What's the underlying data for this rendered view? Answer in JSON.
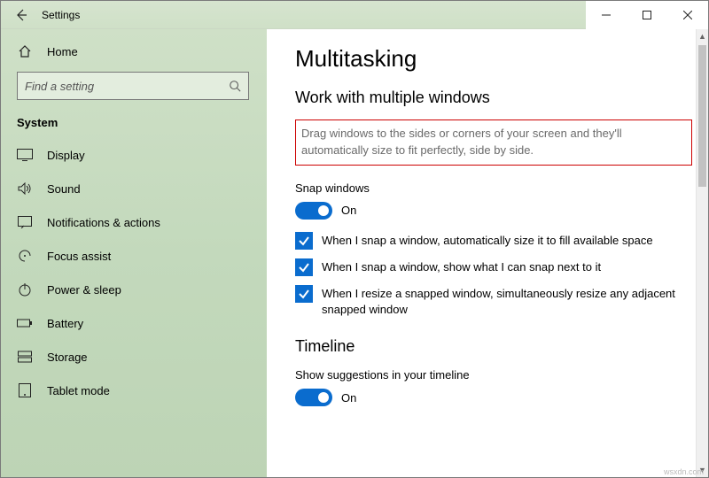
{
  "titlebar": {
    "title": "Settings"
  },
  "sidebar": {
    "home": "Home",
    "search_placeholder": "Find a setting",
    "section": "System",
    "items": [
      {
        "icon": "display",
        "label": "Display"
      },
      {
        "icon": "sound",
        "label": "Sound"
      },
      {
        "icon": "notifications",
        "label": "Notifications & actions"
      },
      {
        "icon": "focus",
        "label": "Focus assist"
      },
      {
        "icon": "power",
        "label": "Power & sleep"
      },
      {
        "icon": "battery",
        "label": "Battery"
      },
      {
        "icon": "storage",
        "label": "Storage"
      },
      {
        "icon": "tablet",
        "label": "Tablet mode"
      }
    ]
  },
  "main": {
    "h1": "Multitasking",
    "h2": "Work with multiple windows",
    "description": "Drag windows to the sides or corners of your screen and they'll automatically size to fit perfectly, side by side.",
    "snap_label": "Snap windows",
    "snap_state": "On",
    "checks": [
      "When I snap a window, automatically size it to fill available space",
      "When I snap a window, show what I can snap next to it",
      "When I resize a snapped window, simultaneously resize any adjacent snapped window"
    ],
    "timeline_h2": "Timeline",
    "timeline_label": "Show suggestions in your timeline",
    "timeline_state": "On"
  },
  "watermark": "wsxdn.com"
}
